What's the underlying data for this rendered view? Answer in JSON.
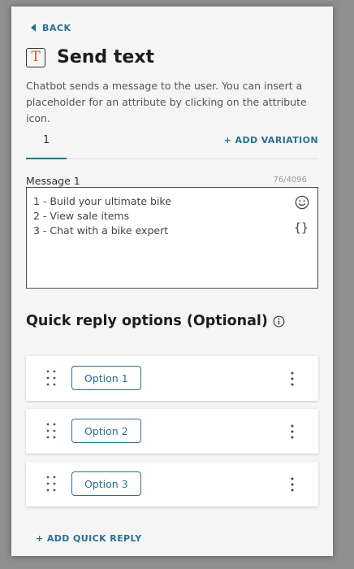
{
  "nav": {
    "back_label": "BACK"
  },
  "header": {
    "icon_letter": "T",
    "title": "Send text"
  },
  "description": "Chatbot sends a message to the user. You can insert a placeholder for an attribute by clicking on the attribute icon.",
  "tabs": [
    {
      "label": "1"
    }
  ],
  "add_variation_label": "+ ADD VARIATION",
  "message": {
    "label": "Message 1",
    "char_count": "76/4096",
    "lines": [
      "1 - Build your ultimate bike",
      "2 - View sale items",
      "3 - Chat with a bike expert"
    ],
    "braces_glyph": "{}"
  },
  "quick_replies": {
    "title": "Quick reply options (Optional)",
    "options": [
      {
        "label": "Option 1"
      },
      {
        "label": "Option 2"
      },
      {
        "label": "Option 3"
      }
    ],
    "add_label": "+ ADD QUICK REPLY"
  },
  "colors": {
    "accent": "#2b6f8f",
    "icon_letter": "#e0571f"
  }
}
